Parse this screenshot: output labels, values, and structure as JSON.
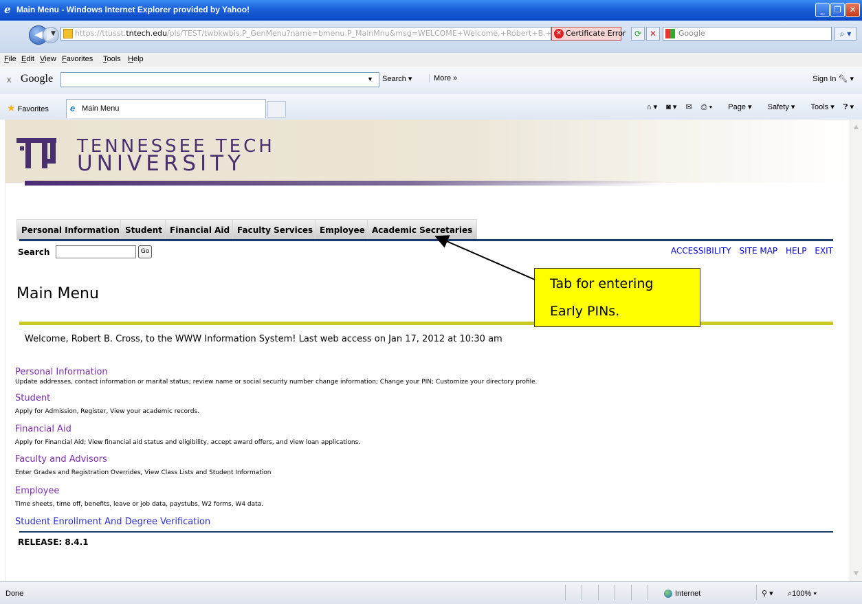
{
  "window": {
    "title": "Main Menu - Windows Internet Explorer provided by Yahoo!"
  },
  "addressbar": {
    "url_prefix": "https://ttusst.",
    "url_domain": "tntech.edu",
    "url_rest": "/pls/TEST/twbkwbis.P_GenMenu?name=bmenu.P_MainMnu&msg=WELCOME+Welcome,+Robert+B.+Cross,+to+the",
    "cert_error": "Certificate Error",
    "search_placeholder": "Google"
  },
  "menubar": [
    "File",
    "Edit",
    "View",
    "Favorites",
    "Tools",
    "Help"
  ],
  "google_toolbar": {
    "close": "x",
    "logo": "Google",
    "search_label": "Search",
    "more_label": "More »",
    "sign_in": "Sign In"
  },
  "tabbar": {
    "favorites": "Favorites",
    "tab_title": "Main Menu",
    "commands": [
      "Page",
      "Safety",
      "Tools"
    ]
  },
  "banner": {
    "line1": "TENNESSEE TECH",
    "line2": "UNIVERSITY"
  },
  "nav_tabs": [
    "Personal Information",
    "Student",
    "Financial Aid",
    "Faculty Services",
    "Employee",
    "Academic Secretaries"
  ],
  "search": {
    "label": "Search",
    "go": "Go"
  },
  "top_links": [
    "ACCESSIBILITY",
    "SITE MAP",
    "HELP",
    "EXIT"
  ],
  "page_title": "Main Menu",
  "welcome": "Welcome, Robert B. Cross, to the WWW Information System! Last web access on Jan 17, 2012 at 10:30 am",
  "menu_items": [
    {
      "title": "Personal Information",
      "desc": "Update addresses, contact information or marital status; review name or social security number change information; Change your PIN; Customize your directory profile."
    },
    {
      "title": "Student",
      "desc": "Apply for Admission, Register, View your academic records."
    },
    {
      "title": "Financial Aid",
      "desc": "Apply for Financial Aid; View financial aid status and eligibility, accept award offers, and view loan applications."
    },
    {
      "title": "Faculty and Advisors",
      "desc": "Enter Grades and Registration Overrides, View Class Lists and Student Information"
    },
    {
      "title": "Employee",
      "desc": "Time sheets, time off, benefits, leave or job data, paystubs, W2 forms, W4 data."
    },
    {
      "title": "Student Enrollment And Degree Verification",
      "desc": ""
    }
  ],
  "release": "RELEASE: 8.4.1",
  "callout": {
    "line1": "Tab for entering",
    "line2": "Early PINs."
  },
  "statusbar": {
    "status": "Done",
    "zone": "Internet",
    "zoom": "100%"
  },
  "colors": {
    "titlebar": "#0a49c9",
    "nav_line": "#1b3a6b",
    "yellow_line": "#c9cb23",
    "visited_link": "#7a2bac",
    "link": "#2c30d6",
    "callout_bg": "#ffff00",
    "tntech_purple": "#4a2f6e"
  }
}
